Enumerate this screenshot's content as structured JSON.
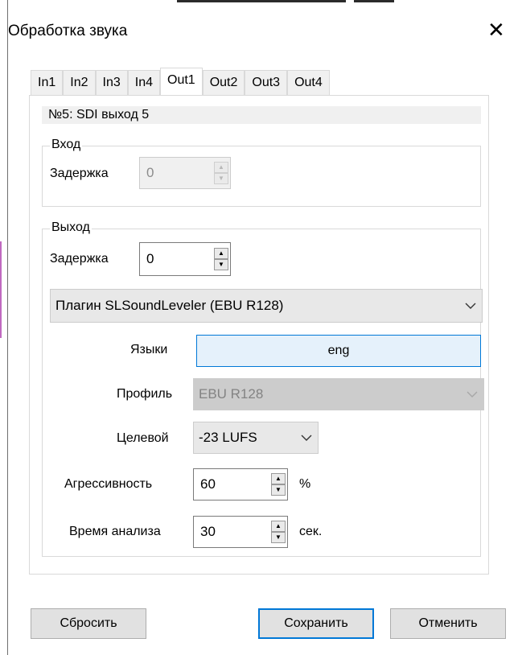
{
  "window": {
    "title": "Обработка звука"
  },
  "tabs": [
    {
      "label": "In1"
    },
    {
      "label": "In2"
    },
    {
      "label": "In3"
    },
    {
      "label": "In4"
    },
    {
      "label": "Out1"
    },
    {
      "label": "Out2"
    },
    {
      "label": "Out3"
    },
    {
      "label": "Out4"
    }
  ],
  "active_tab": "Out1",
  "channel_title": "№5: SDI выход 5",
  "input_group": {
    "label": "Вход",
    "delay_label": "Задержка",
    "delay_value": "0"
  },
  "output_group": {
    "label": "Выход",
    "delay_label": "Задержка",
    "delay_value": "0",
    "plugin": "Плагин SLSoundLeveler (EBU R128)",
    "languages_label": "Языки",
    "languages_value": "eng",
    "profile_label": "Профиль",
    "profile_value": "EBU R128",
    "target_label": "Целевой",
    "target_value": "-23 LUFS",
    "aggressiveness_label": "Агрессивность",
    "aggressiveness_value": "60",
    "aggressiveness_unit": "%",
    "analysis_label": "Время анализа",
    "analysis_value": "30",
    "analysis_unit": "сек."
  },
  "buttons": {
    "reset": "Сбросить",
    "save": "Сохранить",
    "cancel": "Отменить"
  },
  "colors": {
    "accent": "#0078d7",
    "language_fill": "#e5f1fb"
  }
}
